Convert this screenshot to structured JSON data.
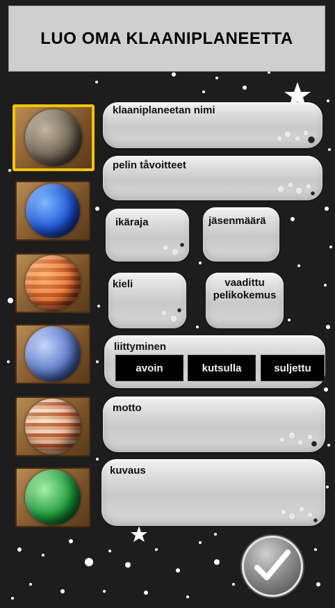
{
  "header": {
    "title": "LUO OMA KLAANIPLANEETTA"
  },
  "planets": [
    {
      "name": "rocky-planet",
      "colors": [
        "#c2b7a0",
        "#6f6453",
        "#2e261d"
      ],
      "selected": true
    },
    {
      "name": "blue-planet",
      "colors": [
        "#7fb8ff",
        "#1f56d8",
        "#0a1a66"
      ],
      "selected": false
    },
    {
      "name": "orange-planet",
      "colors": [
        "#ffb165",
        "#d8581c",
        "#6a1d08"
      ],
      "selected": false
    },
    {
      "name": "moon-blue-planet",
      "colors": [
        "#c7d6ff",
        "#5877c4",
        "#1e2d6a"
      ],
      "selected": false
    },
    {
      "name": "striped-planet",
      "colors": [
        "#f3dcc2",
        "#c4683f",
        "#6e2a14"
      ],
      "selected": false
    },
    {
      "name": "green-planet",
      "colors": [
        "#a8f0a6",
        "#1c9b3a",
        "#06421a"
      ],
      "selected": false
    }
  ],
  "form": {
    "clan_name_label": "klaaniplaneetan nimi",
    "goals_label": "pelin tåvoitteet",
    "age_limit_label": "ikäraja",
    "member_count_label": "jäsenmäärä",
    "language_label": "kieli",
    "experience_label_line1": "vaadittu",
    "experience_label_line2": "pelikokemus",
    "joining_label": "liittyminen",
    "join_options": [
      "avoin",
      "kutsulla",
      "suljettu"
    ],
    "motto_label": "motto",
    "description_label": "kuvaus"
  },
  "confirm": {
    "icon": "checkmark-icon"
  }
}
